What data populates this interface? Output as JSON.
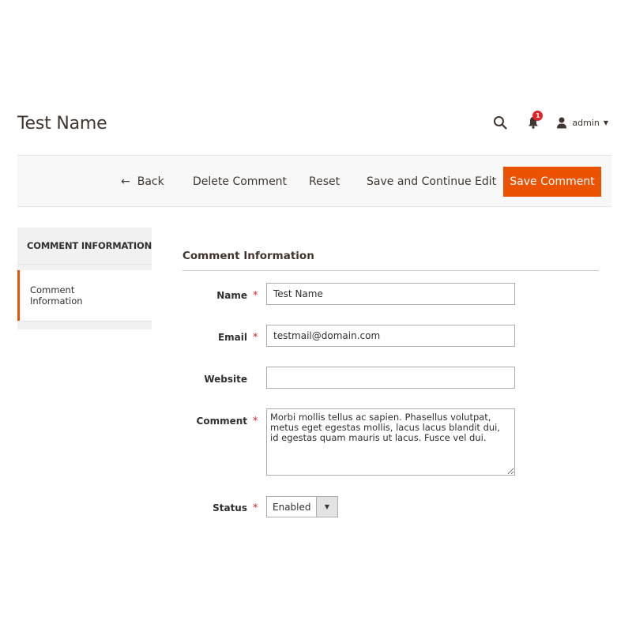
{
  "header": {
    "title": "Test Name",
    "notification_count": "1",
    "user_name": "admin",
    "icons": {
      "search": "search-icon",
      "bell": "bell-icon",
      "user": "user-icon",
      "caret": "caret-down-icon"
    }
  },
  "toolbar": {
    "back_label": "Back",
    "delete_label": "Delete Comment",
    "reset_label": "Reset",
    "continue_label": "Save and Continue Edit",
    "save_label": "Save Comment",
    "accent_color": "#eb5202"
  },
  "sidebar": {
    "title": "COMMENT INFORMATION",
    "items": [
      {
        "label": "Comment Information",
        "active": true
      }
    ]
  },
  "form": {
    "legend": "Comment Information",
    "fields": {
      "name": {
        "label": "Name",
        "value": "Test Name",
        "required": true
      },
      "email": {
        "label": "Email",
        "value": "testmail@domain.com",
        "required": true
      },
      "website": {
        "label": "Website",
        "value": "",
        "required": false
      },
      "comment": {
        "label": "Comment",
        "value": "Morbi mollis tellus ac sapien. Phasellus volutpat, metus eget egestas mollis, lacus lacus blandit dui, id egestas quam mauris ut lacus. Fusce vel dui.",
        "required": true
      },
      "status": {
        "label": "Status",
        "value": "Enabled",
        "required": true
      }
    },
    "required_marker": "*",
    "required_color": "#e22626"
  }
}
